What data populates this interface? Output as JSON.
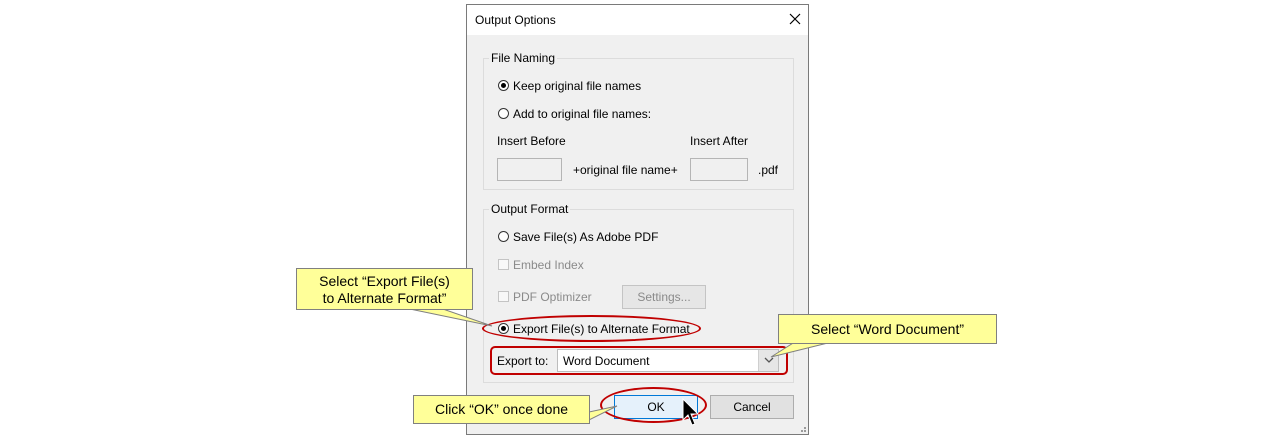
{
  "dialog": {
    "title": "Output Options",
    "file_naming": {
      "group_label": "File Naming",
      "keep_original": "Keep original file names",
      "add_to_original": "Add to original file names:",
      "insert_before_label": "Insert Before",
      "insert_after_label": "Insert After",
      "insert_before_value": "",
      "insert_after_value": "",
      "middle_text": "+original file name+",
      "extension": ".pdf",
      "selected": "keep_original"
    },
    "output_format": {
      "group_label": "Output Format",
      "save_as_pdf": "Save File(s) As Adobe PDF",
      "embed_index": "Embed Index",
      "pdf_optimizer": "PDF Optimizer",
      "settings_button": "Settings...",
      "export_alternate": "Export File(s) to Alternate Format",
      "export_to_label": "Export to:",
      "export_to_value": "Word Document",
      "selected": "export_alternate"
    },
    "ok_button": "OK",
    "cancel_button": "Cancel"
  },
  "callouts": {
    "select_export_line1": "Select “Export File(s)",
    "select_export_line2": "to Alternate Format”",
    "select_word": "Select “Word Document”",
    "click_ok": "Click “OK” once done"
  },
  "colors": {
    "highlight_ring": "#c00000",
    "callout_fill": "#ffff99"
  }
}
